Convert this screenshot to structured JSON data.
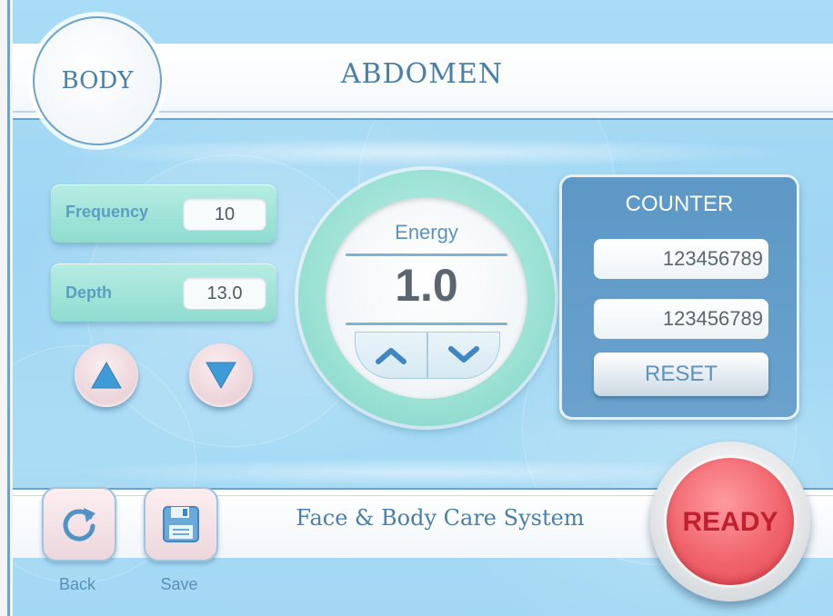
{
  "header": {
    "mode_label": "BODY",
    "title": "ABDOMEN"
  },
  "params": {
    "frequency": {
      "label": "Frequency",
      "value": "10"
    },
    "depth": {
      "label": "Depth",
      "value": "13.0"
    },
    "up_icon": "triangle-up-icon",
    "down_icon": "triangle-down-icon"
  },
  "energy": {
    "label": "Energy",
    "value": "1.0",
    "increase_icon": "chevron-up-icon",
    "decrease_icon": "chevron-down-icon"
  },
  "counter": {
    "title": "COUNTER",
    "values": [
      "123456789",
      "123456789"
    ],
    "reset_label": "RESET"
  },
  "footer": {
    "system_name": "Face & Body Care System",
    "back_label": "Back",
    "save_label": "Save",
    "ready_label": "READY"
  },
  "colors": {
    "accent_blue": "#4a7fa9",
    "panel_blue": "#5d98c6",
    "mint": "#8fdccf",
    "ready_red": "#e34a55"
  }
}
